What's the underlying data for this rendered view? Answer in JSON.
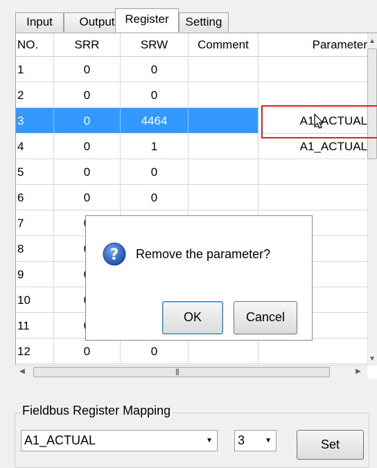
{
  "tabs": [
    "Input",
    "Output",
    "Register",
    "Setting"
  ],
  "active_tab": "Register",
  "table": {
    "columns": [
      "NO.",
      "SRR",
      "SRW",
      "Comment",
      "Parameter"
    ],
    "rows": [
      {
        "no": "1",
        "srr": "0",
        "srw": "0",
        "comment": "",
        "param": ""
      },
      {
        "no": "2",
        "srr": "0",
        "srw": "0",
        "comment": "",
        "param": ""
      },
      {
        "no": "3",
        "srr": "0",
        "srw": "4464",
        "comment": "",
        "param": "A1_ACTUAL"
      },
      {
        "no": "4",
        "srr": "0",
        "srw": "1",
        "comment": "",
        "param": "A1_ACTUAL"
      },
      {
        "no": "5",
        "srr": "0",
        "srw": "0",
        "comment": "",
        "param": ""
      },
      {
        "no": "6",
        "srr": "0",
        "srw": "0",
        "comment": "",
        "param": ""
      },
      {
        "no": "7",
        "srr": "0",
        "srw": "",
        "comment": "",
        "param": ""
      },
      {
        "no": "8",
        "srr": "0",
        "srw": "",
        "comment": "",
        "param": ""
      },
      {
        "no": "9",
        "srr": "0",
        "srw": "",
        "comment": "",
        "param": ""
      },
      {
        "no": "10",
        "srr": "0",
        "srw": "",
        "comment": "",
        "param": ""
      },
      {
        "no": "11",
        "srr": "0",
        "srw": "",
        "comment": "",
        "param": ""
      },
      {
        "no": "12",
        "srr": "0",
        "srw": "0",
        "comment": "",
        "param": ""
      }
    ],
    "selected_row": 3
  },
  "dialog": {
    "message": "Remove the parameter?",
    "ok_label": "OK",
    "cancel_label": "Cancel",
    "icon": "question-icon"
  },
  "mapping": {
    "title": "Fieldbus Register Mapping",
    "parameter_value": "A1_ACTUAL",
    "index_value": "3",
    "set_label": "Set"
  },
  "colors": {
    "selection": "#3399ff",
    "highlight_box": "#e02020",
    "question_icon": "#1f5fbf"
  }
}
